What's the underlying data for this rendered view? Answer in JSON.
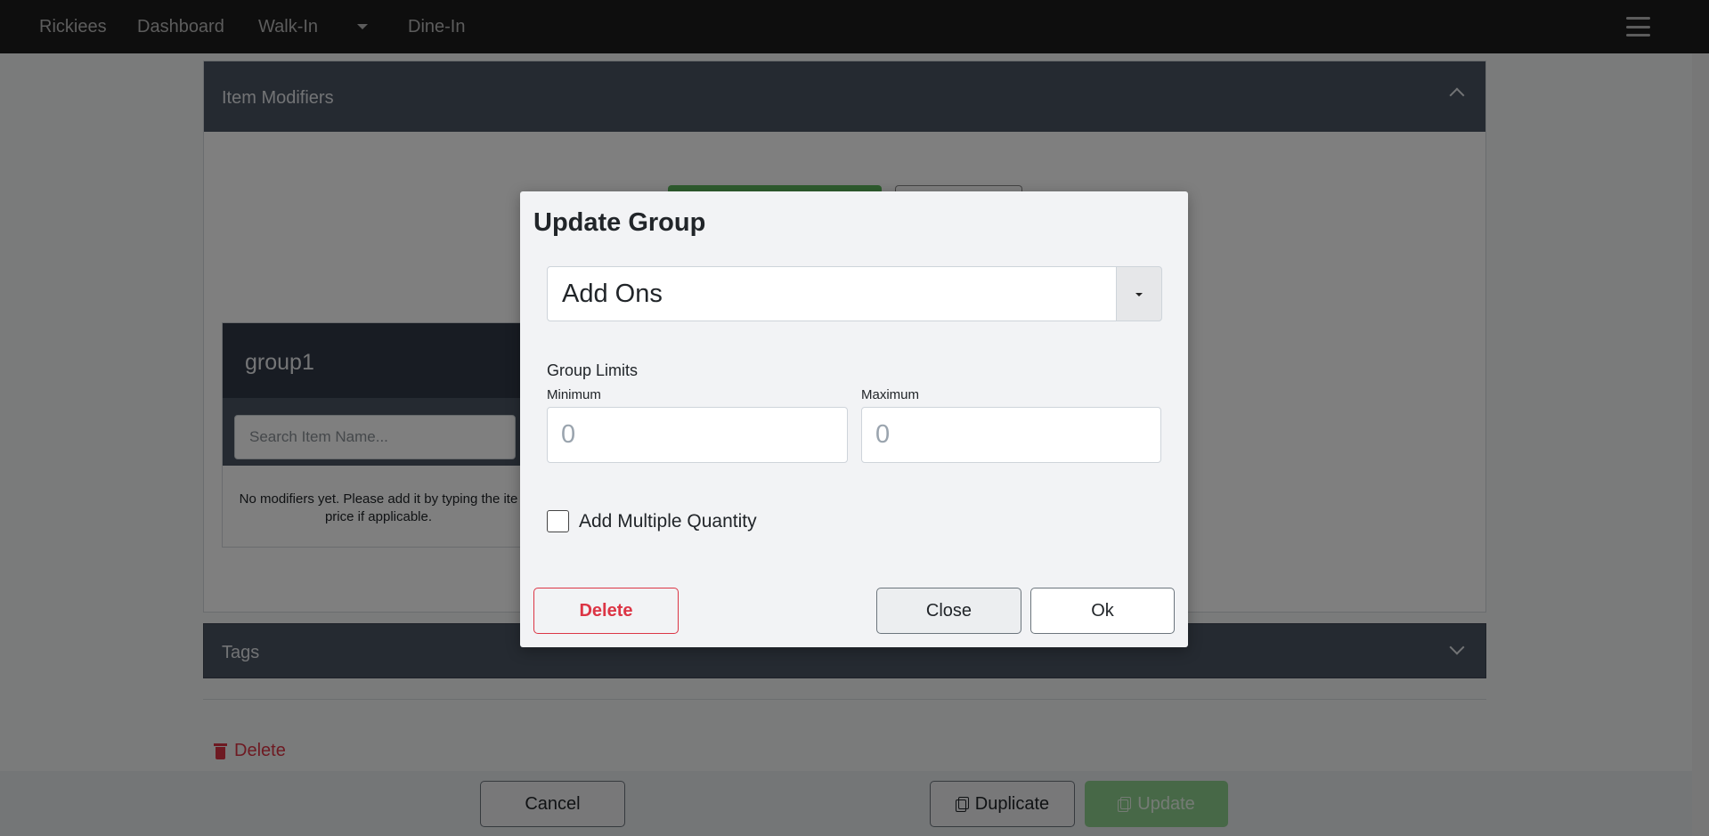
{
  "nav": {
    "brand": "Rickiees",
    "dashboard": "Dashboard",
    "walk_in": "Walk-In",
    "dine_in": "Dine-In"
  },
  "modifiers": {
    "title": "Item Modifiers",
    "group": {
      "name": "group1",
      "search_placeholder": "Search Item Name...",
      "empty_text": "No modifiers yet. Please add it by typing the ite price if applicable."
    }
  },
  "tags": {
    "title": "Tags"
  },
  "page_actions": {
    "delete": "Delete",
    "cancel": "Cancel",
    "duplicate": "Duplicate",
    "update": "Update"
  },
  "modal": {
    "title": "Update Group",
    "selected_group": "Add Ons",
    "limits_label": "Group Limits",
    "minimum_label": "Minimum",
    "maximum_label": "Maximum",
    "minimum_placeholder": "0",
    "maximum_placeholder": "0",
    "multiple_quantity_label": "Add Multiple Quantity",
    "multiple_quantity_checked": false,
    "delete_label": "Delete",
    "close_label": "Close",
    "ok_label": "Ok"
  },
  "colors": {
    "nav_bg": "#1c1c1c",
    "card_header": "#4a5463",
    "danger": "#dc3545",
    "success": "#5cb85c"
  }
}
